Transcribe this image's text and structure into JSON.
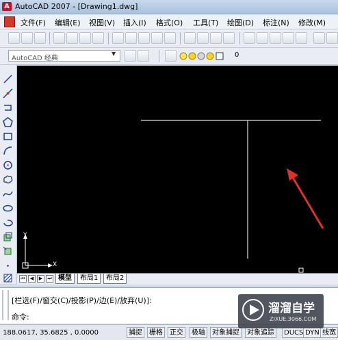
{
  "window": {
    "title": "AutoCAD 2007 - [Drawing1.dwg]",
    "app_icon": "A"
  },
  "menu": {
    "items": [
      "文件(F)",
      "编辑(E)",
      "视图(V)",
      "插入(I)",
      "格式(O)",
      "工具(T)",
      "绘图(D)",
      "标注(N)",
      "修改(M)"
    ]
  },
  "workspace": {
    "selected": "AutoCAD 经典"
  },
  "layer": {
    "current": "0"
  },
  "ucs": {
    "x_label": "X",
    "y_label": "Y"
  },
  "tabs": {
    "model": "模型",
    "layout1": "布局1",
    "layout2": "布局2"
  },
  "command": {
    "options_line": "[栏选(F)/窗交(C)/投影(P)/边(E)/放弃(U)]:",
    "prompt": "命令:"
  },
  "status": {
    "coords": "188.0617,  35.6825 , 0.0000",
    "buttons": [
      "捕捉",
      "栅格",
      "正交",
      "极轴",
      "对象捕捉",
      "对象追踪",
      "DUCS",
      "DYN",
      "线宽"
    ]
  },
  "watermark": {
    "brand": "溜溜自学",
    "url": "ZIXUE.3066.COM"
  },
  "colors": {
    "canvas": "#000000",
    "drawn_lines": "#e0e0e0",
    "annotation_arrow": "#e0302a",
    "watermark_bg": "#3a3f4a"
  }
}
